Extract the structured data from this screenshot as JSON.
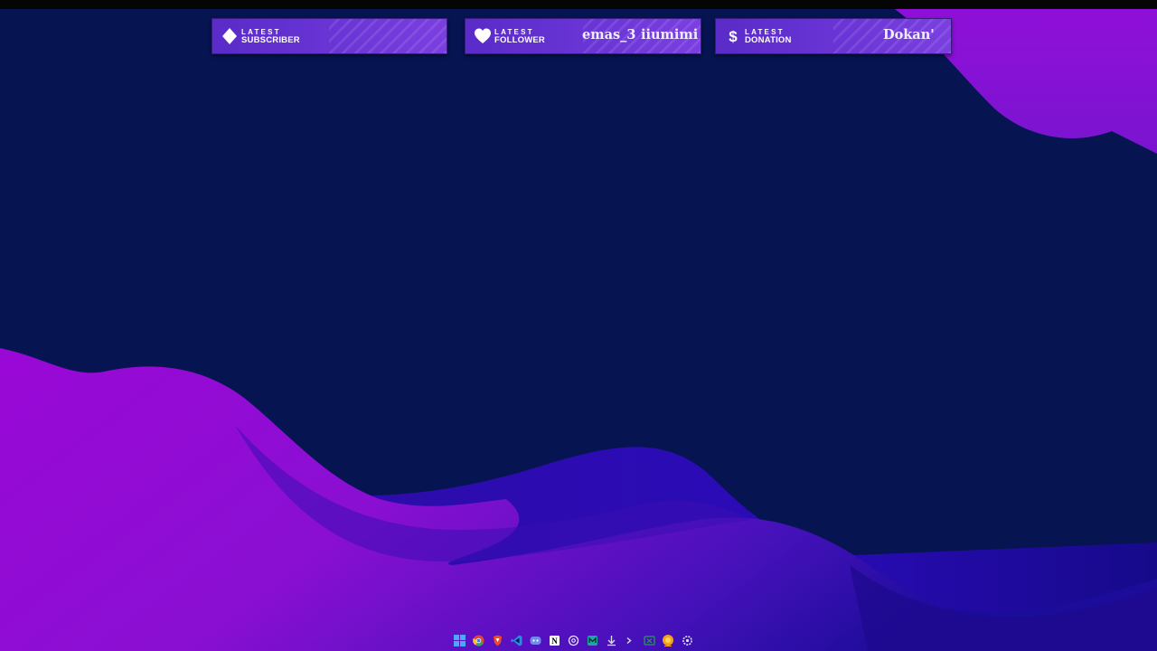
{
  "alerts": {
    "subscriber": {
      "top": "LATEST",
      "bottom": "SUBSCRIBER",
      "name": ""
    },
    "follower": {
      "top": "LATEST",
      "bottom": "FOLLOWER",
      "names": [
        "emas_3",
        "iiumimi"
      ]
    },
    "donation": {
      "top": "LATEST",
      "bottom": "DONATION",
      "name": "Dokan'"
    }
  },
  "taskbar": {
    "icons": [
      "windows-start-icon",
      "chrome-icon",
      "brave-icon",
      "vscode-icon",
      "discord-icon",
      "notion-icon",
      "settings-icon",
      "terminal-icon",
      "download-icon",
      "cmd-icon",
      "excel-icon",
      "orange-app-icon",
      "settings-gear-icon"
    ]
  },
  "colors": {
    "background": "#061452",
    "wave_purple": "#8d10d8",
    "wave_blue": "#1f0aa8",
    "alert_purple": "#6a35d6"
  }
}
